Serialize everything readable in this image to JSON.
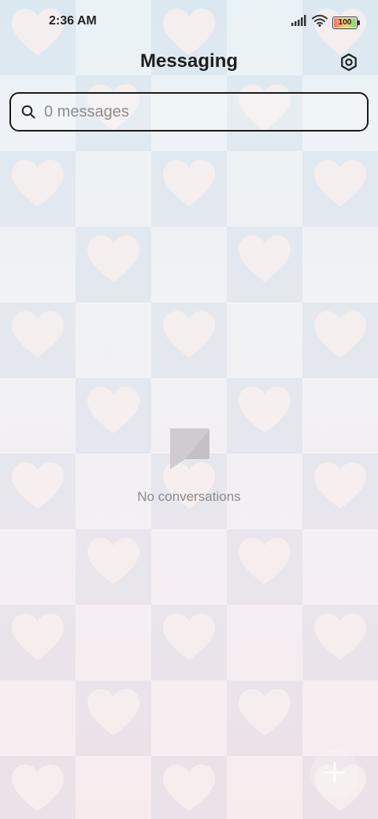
{
  "status_bar": {
    "time": "2:36 AM",
    "battery_level": "100",
    "icons": [
      "signal-icon",
      "wifi-icon",
      "battery-icon"
    ]
  },
  "header": {
    "title": "Messaging",
    "settings_icon": "settings-icon"
  },
  "search": {
    "placeholder": "0 messages",
    "value": "",
    "icon": "search-icon"
  },
  "empty_state": {
    "icon": "empty-chat-icon",
    "text": "No conversations"
  },
  "compose": {
    "icon": "plus-icon"
  },
  "colors": {
    "accent_dark": "#1a1a1a",
    "muted_text": "#8a8a8a",
    "heart": "#f8eeee"
  }
}
